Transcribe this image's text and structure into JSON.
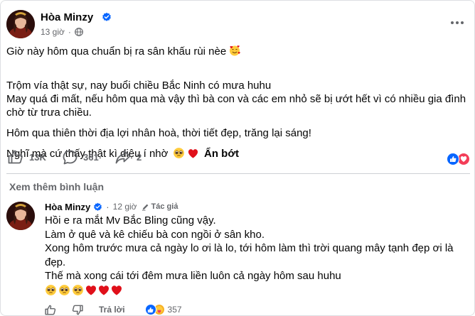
{
  "post": {
    "author": "Hòa Minzy",
    "time": "13 giờ",
    "dot": "·",
    "more_icon": "more-horizontal-icon",
    "paragraphs": [
      {
        "text": "Giờ này hôm qua chuẩn bị ra sân khấu rùi nèe",
        "emoji": "smiling-face-with-hearts"
      },
      {
        "text": "Trộm vía thật sự, nay buổi chiều Bắc Ninh có mưa huhu\nMay quá đi mất, nếu hôm qua mà vậy thì bà con và các em nhỏ sẽ bị ướt hết vì có nhiều gia đình chờ từ trưa chiều."
      },
      {
        "text": "Hôm qua thiên thời địa lợi nhân hoà, thời tiết đẹp, trăng lại sáng!"
      },
      {
        "text": "Nghĩ mà cứ thấy thật kì diệu í nhờ",
        "see_less": "Ẩn bớt"
      }
    ],
    "likes": "13K",
    "comments": "361",
    "shares": "2"
  },
  "comments_section": {
    "see_more": "Xem thêm bình luận"
  },
  "comment": {
    "author": "Hòa Minzy",
    "time": "12 giờ",
    "dot": "·",
    "badge": "Tác giả",
    "lines": [
      "Hồi e ra mắt Mv Bắc Bling cũng vậy.",
      "Làm ở quê và kê chiếu bà con ngồi ở sân kho.",
      "Xong hôm trước mưa cả ngày lo ơi là lo, tới hôm làm thì trời quang mây tạnh đẹp ơi là đẹp.",
      "Thế mà xong cái tới đêm mưa liền luôn cả ngày hôm sau huhu"
    ],
    "reply_label": "Trả lời",
    "reaction_count": "357"
  },
  "colors": {
    "brand_blue": "#0866ff",
    "secondary_text": "#65676b",
    "love_red": "#f33e58",
    "heart_red": "#e0101a"
  }
}
